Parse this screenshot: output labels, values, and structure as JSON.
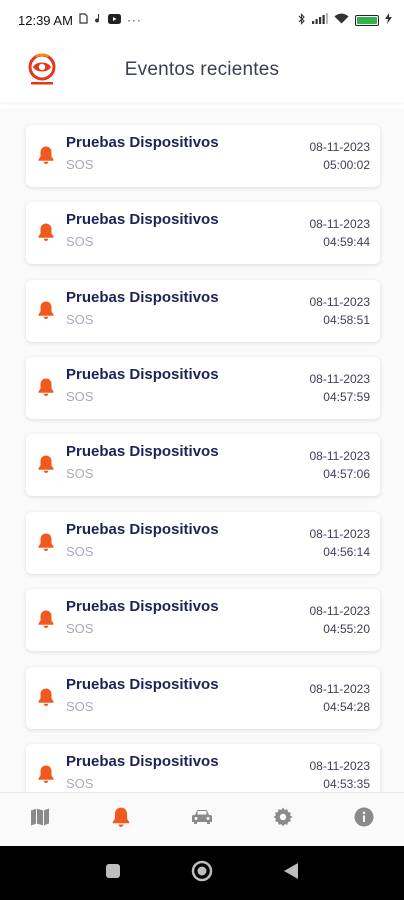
{
  "status_bar": {
    "time": "12:39 AM",
    "left_icons": [
      "sim-icon",
      "music-note-icon",
      "youtube-icon",
      "more-icon"
    ],
    "right_icons": [
      "bluetooth-icon",
      "signal-icon",
      "wifi-icon",
      "battery-icon",
      "charging-icon"
    ],
    "battery_level": 1.0
  },
  "header": {
    "title": "Eventos recientes",
    "logo_icon": "brand-logo-icon"
  },
  "colors": {
    "accent": "#f05a1e",
    "title_text": "#1e2356",
    "subtitle_text": "#a7a9bd",
    "nav_inactive": "#8a8a8a"
  },
  "events": [
    {
      "title": "Pruebas Dispositivos",
      "type": "SOS",
      "date": "08-11-2023",
      "time": "05:00:02",
      "icon": "bell-icon"
    },
    {
      "title": "Pruebas Dispositivos",
      "type": "SOS",
      "date": "08-11-2023",
      "time": "04:59:44",
      "icon": "bell-icon"
    },
    {
      "title": "Pruebas Dispositivos",
      "type": "SOS",
      "date": "08-11-2023",
      "time": "04:58:51",
      "icon": "bell-icon"
    },
    {
      "title": "Pruebas Dispositivos",
      "type": "SOS",
      "date": "08-11-2023",
      "time": "04:57:59",
      "icon": "bell-icon"
    },
    {
      "title": "Pruebas Dispositivos",
      "type": "SOS",
      "date": "08-11-2023",
      "time": "04:57:06",
      "icon": "bell-icon"
    },
    {
      "title": "Pruebas Dispositivos",
      "type": "SOS",
      "date": "08-11-2023",
      "time": "04:56:14",
      "icon": "bell-icon"
    },
    {
      "title": "Pruebas Dispositivos",
      "type": "SOS",
      "date": "08-11-2023",
      "time": "04:55:20",
      "icon": "bell-icon"
    },
    {
      "title": "Pruebas Dispositivos",
      "type": "SOS",
      "date": "08-11-2023",
      "time": "04:54:28",
      "icon": "bell-icon"
    },
    {
      "title": "Pruebas Dispositivos",
      "type": "SOS",
      "date": "08-11-2023",
      "time": "04:53:35",
      "icon": "bell-icon"
    }
  ],
  "bottom_nav": [
    {
      "icon": "map-icon",
      "active": false
    },
    {
      "icon": "bell-icon",
      "active": true
    },
    {
      "icon": "car-icon",
      "active": false
    },
    {
      "icon": "gear-icon",
      "active": false
    },
    {
      "icon": "info-icon",
      "active": false
    }
  ],
  "system_nav": [
    "recents-square-icon",
    "home-circle-icon",
    "back-triangle-icon"
  ]
}
